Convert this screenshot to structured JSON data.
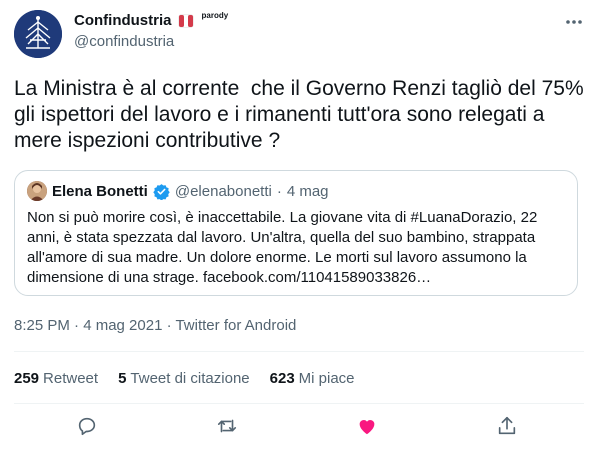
{
  "author": {
    "display_name": "Confindustria",
    "flag_icon": "italian-flag-icon",
    "parody_label": "parody",
    "handle": "@confindustria"
  },
  "tweet": {
    "text": "La Ministra è al corrente  che il Governo Renzi tagliò del 75% gli ispettori del lavoro e i rimanenti tutt'ora sono relegati a mere ispezioni contributive ?"
  },
  "quote": {
    "display_name": "Elena Bonetti",
    "handle": "@elenabonetti",
    "separator": "·",
    "date": "4 mag",
    "text": "Non si può morire così, è inaccettabile. La giovane vita di #LuanaDorazio, 22 anni, è stata spezzata dal lavoro. Un'altra, quella del suo bambino, strappata all'amore di sua madre. Un dolore enorme. Le morti sul lavoro assumono la dimensione di una strage. facebook.com/11041589033826…"
  },
  "meta": {
    "text": "8:25 PM · 4 mag 2021 · Twitter for Android"
  },
  "stats": {
    "retweets_count": "259",
    "retweets_label": "Retweet",
    "quotes_count": "5",
    "quotes_label": "Tweet di citazione",
    "likes_count": "623",
    "likes_label": "Mi piace"
  },
  "colors": {
    "text": "#0f1419",
    "secondary": "#536471",
    "like_active": "#f91880",
    "verified": "#1d9bf0",
    "border": "#cfd9de"
  }
}
